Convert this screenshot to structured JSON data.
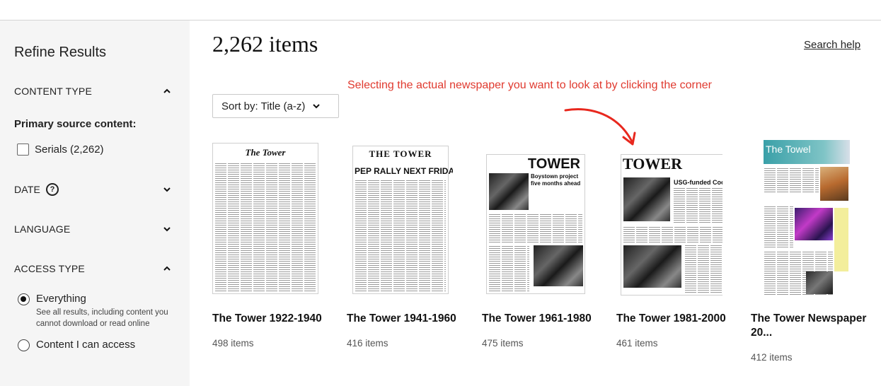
{
  "sidebar": {
    "title": "Refine Results",
    "content_type": {
      "label": "CONTENT TYPE",
      "state": "expanded"
    },
    "primary_source_label": "Primary source content:",
    "serials_option": "Serials (2,262)",
    "date": {
      "label": "DATE",
      "state": "collapsed"
    },
    "language": {
      "label": "LANGUAGE",
      "state": "collapsed"
    },
    "access_type": {
      "label": "ACCESS TYPE",
      "state": "expanded"
    },
    "access_options": [
      {
        "label": "Everything",
        "description": "See all results, including content you cannot download or read online",
        "selected": true
      },
      {
        "label": "Content I can access",
        "selected": false
      }
    ]
  },
  "main": {
    "items_count": "2,262 items",
    "search_help": "Search help",
    "annotation": "Selecting the actual newspaper you want to look at by clicking the corner",
    "sort_label": "Sort by: Title (a-z)",
    "cards": [
      {
        "title": "The Tower 1922-1940",
        "count": "498 items",
        "masthead": "The Tower"
      },
      {
        "title": "The Tower 1941-1960",
        "count": "416 items",
        "masthead": "THE TOWER",
        "headline": "PEP RALLY NEXT FRIDAY"
      },
      {
        "title": "The Tower 1961-1980",
        "count": "475 items",
        "masthead": "TOWER",
        "headline": "Boystown project five months ahead"
      },
      {
        "title": "The Tower 1981-2000",
        "count": "461 items",
        "masthead": "TOWER",
        "headline": "USG-funded Coop opens"
      },
      {
        "title": "The Tower Newspaper 20...",
        "count": "412 items",
        "masthead": "The Towel"
      }
    ]
  },
  "colors": {
    "annotation": "#e03a2f",
    "sidebar_bg": "#f5f5f5",
    "towel_header": "#3aa0a8"
  }
}
